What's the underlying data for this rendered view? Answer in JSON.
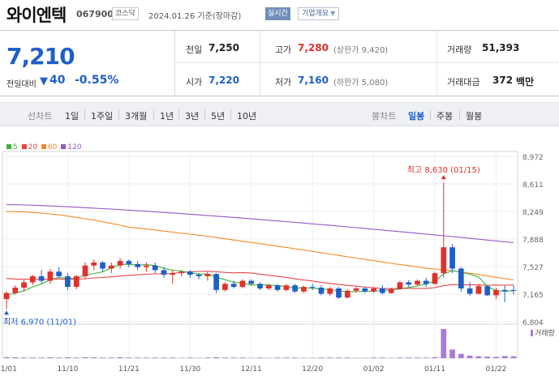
{
  "header": {
    "stock_name": "와이엔텍",
    "stock_code": "067900",
    "market_badge": "코스닥",
    "date_basis": "2024.01.26  기준(장마감)",
    "realtime_badge": "실시간",
    "company_info_button": "기업개요",
    "caret": "▼"
  },
  "quote": {
    "price": "7,210",
    "change_label": "전일대비",
    "change_arrow": "▼",
    "change_value": "40",
    "change_percent": "-0.55%",
    "prev_close_label": "전일",
    "prev_close": "7,250",
    "high_label": "고가",
    "high": "7,280",
    "upper_limit": "(상한가 9,420)",
    "volume_label": "거래량",
    "volume": "51,393",
    "open_label": "시가",
    "open": "7,220",
    "low_label": "저가",
    "low": "7,160",
    "lower_limit": "(하한가 5,080)",
    "trade_value_label": "거래대금",
    "trade_value": "372",
    "trade_value_unit": "백만"
  },
  "tabs": {
    "line_chart_label": "선차트",
    "line_periods": [
      "1일",
      "1주일",
      "3개월",
      "1년",
      "3년",
      "5년",
      "10년"
    ],
    "candle_chart_label": "봉차트",
    "candle_periods": [
      "일봉",
      "주봉",
      "월봉"
    ],
    "candle_active": "일봉"
  },
  "colors": {
    "up": "#e0302d",
    "down": "#1f5fc9",
    "ma5": "#3cb23c",
    "ma20": "#e84545",
    "ma60": "#f08a24",
    "ma120": "#9a55c9",
    "volume": "#a97bd6"
  },
  "chart_data": {
    "type": "candlestick",
    "legend": [
      "5",
      "20",
      "60",
      "120"
    ],
    "y_ticks": [
      8972,
      8611,
      8249,
      7888,
      7527,
      7165,
      6804
    ],
    "y_tick_labels": [
      "8,972",
      "8,611",
      "8,249",
      "7,888",
      "7,527",
      "7,165",
      "6,804"
    ],
    "ylim": [
      6804,
      8972
    ],
    "x_tick_labels": [
      "11/01",
      "11/10",
      "11/21",
      "11/30",
      "12/11",
      "12/20",
      "01/02",
      "01/11",
      "01/22"
    ],
    "x_tick_index": [
      0,
      7,
      14,
      21,
      28,
      35,
      42,
      49,
      56
    ],
    "high_annotation": "최고 8,630 (01/15)",
    "low_annotation": "최저 6,970 (11/01)",
    "volume_label": "거래량",
    "candles": [
      [
        7100,
        7200,
        6970,
        7180
      ],
      [
        7180,
        7280,
        7160,
        7250
      ],
      [
        7250,
        7350,
        7200,
        7320
      ],
      [
        7320,
        7420,
        7280,
        7400
      ],
      [
        7400,
        7480,
        7300,
        7340
      ],
      [
        7340,
        7500,
        7300,
        7460
      ],
      [
        7460,
        7520,
        7380,
        7400
      ],
      [
        7400,
        7440,
        7220,
        7260
      ],
      [
        7260,
        7420,
        7230,
        7400
      ],
      [
        7400,
        7580,
        7360,
        7540
      ],
      [
        7540,
        7620,
        7480,
        7580
      ],
      [
        7580,
        7600,
        7460,
        7500
      ],
      [
        7500,
        7580,
        7440,
        7540
      ],
      [
        7540,
        7640,
        7500,
        7600
      ],
      [
        7600,
        7620,
        7520,
        7560
      ],
      [
        7560,
        7600,
        7480,
        7520
      ],
      [
        7520,
        7580,
        7460,
        7540
      ],
      [
        7540,
        7580,
        7440,
        7480
      ],
      [
        7480,
        7520,
        7380,
        7420
      ],
      [
        7420,
        7480,
        7300,
        7440
      ],
      [
        7440,
        7480,
        7400,
        7460
      ],
      [
        7460,
        7480,
        7380,
        7420
      ],
      [
        7420,
        7440,
        7360,
        7400
      ],
      [
        7400,
        7460,
        7340,
        7430
      ],
      [
        7430,
        7440,
        7180,
        7220
      ],
      [
        7220,
        7320,
        7200,
        7300
      ],
      [
        7300,
        7340,
        7240,
        7260
      ],
      [
        7260,
        7360,
        7240,
        7340
      ],
      [
        7340,
        7360,
        7280,
        7300
      ],
      [
        7300,
        7320,
        7220,
        7240
      ],
      [
        7240,
        7300,
        7220,
        7280
      ],
      [
        7280,
        7300,
        7200,
        7220
      ],
      [
        7220,
        7300,
        7200,
        7280
      ],
      [
        7280,
        7300,
        7180,
        7200
      ],
      [
        7200,
        7280,
        7180,
        7260
      ],
      [
        7260,
        7300,
        7220,
        7250
      ],
      [
        7250,
        7280,
        7150,
        7170
      ],
      [
        7170,
        7260,
        7140,
        7240
      ],
      [
        7240,
        7260,
        7100,
        7120
      ],
      [
        7120,
        7230,
        7110,
        7210
      ],
      [
        7210,
        7260,
        7190,
        7240
      ],
      [
        7240,
        7260,
        7180,
        7200
      ],
      [
        7200,
        7260,
        7180,
        7240
      ],
      [
        7240,
        7280,
        7160,
        7180
      ],
      [
        7180,
        7250,
        7170,
        7230
      ],
      [
        7230,
        7340,
        7220,
        7320
      ],
      [
        7320,
        7350,
        7260,
        7290
      ],
      [
        7290,
        7360,
        7280,
        7340
      ],
      [
        7340,
        7380,
        7260,
        7300
      ],
      [
        7300,
        7460,
        7290,
        7440
      ],
      [
        7440,
        8630,
        7380,
        7780
      ],
      [
        7780,
        7820,
        7440,
        7500
      ],
      [
        7500,
        7520,
        7200,
        7240
      ],
      [
        7240,
        7320,
        7140,
        7170
      ],
      [
        7170,
        7300,
        7160,
        7270
      ],
      [
        7270,
        7280,
        7140,
        7150
      ],
      [
        7150,
        7250,
        7100,
        7220
      ],
      [
        7220,
        7280,
        7060,
        7200
      ],
      [
        7220,
        7280,
        7160,
        7210
      ]
    ],
    "volumes": [
      3,
      3,
      2,
      2,
      2,
      3,
      2,
      3,
      2,
      3,
      3,
      2,
      2,
      3,
      2,
      2,
      2,
      2,
      2,
      2,
      1,
      2,
      1,
      2,
      3,
      2,
      2,
      2,
      1,
      2,
      1,
      2,
      2,
      2,
      1,
      1,
      2,
      2,
      2,
      2,
      1,
      1,
      2,
      2,
      1,
      2,
      2,
      2,
      2,
      3,
      95,
      28,
      14,
      8,
      6,
      5,
      4,
      7,
      6
    ]
  }
}
